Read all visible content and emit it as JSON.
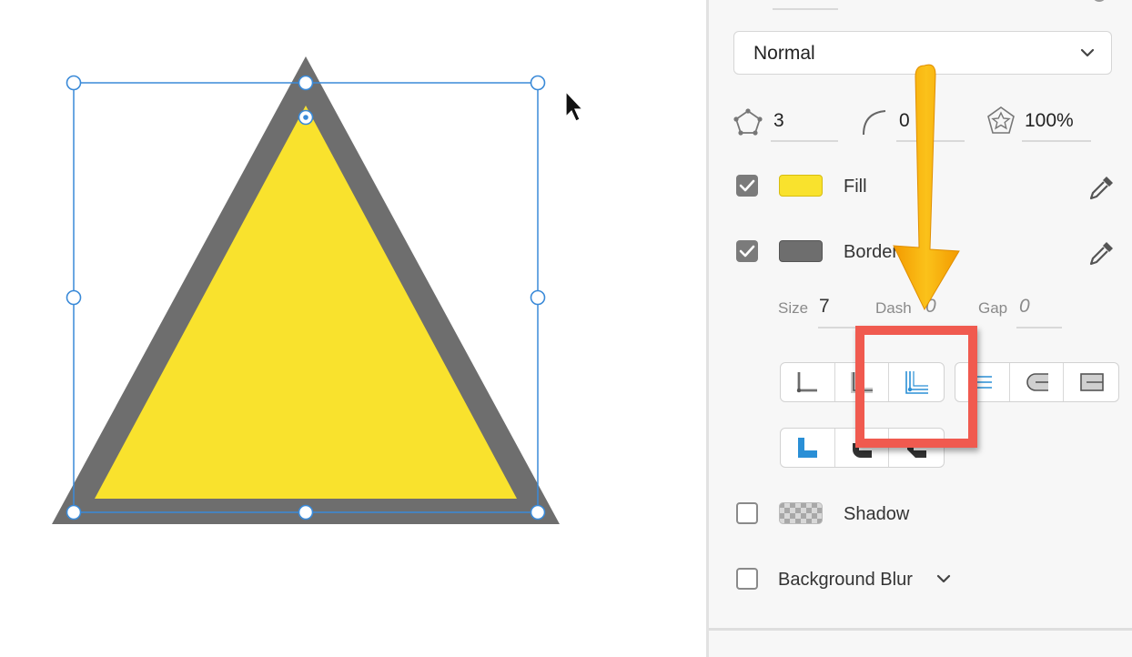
{
  "canvas": {
    "shape": "triangle",
    "fill_color": "#f9e22d",
    "border_color": "#6e6e6e",
    "selection_color": "#3a8ad8"
  },
  "panel": {
    "blend_mode": {
      "value": "Normal",
      "icon": "chevron-down-icon"
    },
    "polygon": {
      "sides": "3",
      "corner_radius": "0",
      "star_ratio": "100%"
    },
    "fill": {
      "enabled": true,
      "label": "Fill",
      "color": "#f9e22d"
    },
    "border": {
      "enabled": true,
      "label": "Border",
      "color": "#6e6e6e",
      "size_label": "Size",
      "size": "7",
      "dash_label": "Dash",
      "dash": "0",
      "gap_label": "Gap",
      "gap": "0"
    },
    "shadow": {
      "enabled": false,
      "label": "Shadow"
    },
    "background_blur": {
      "enabled": false,
      "label": "Background Blur"
    }
  },
  "annotation": {
    "arrow_color": "#f7b500",
    "box_color": "#f05a4f"
  }
}
